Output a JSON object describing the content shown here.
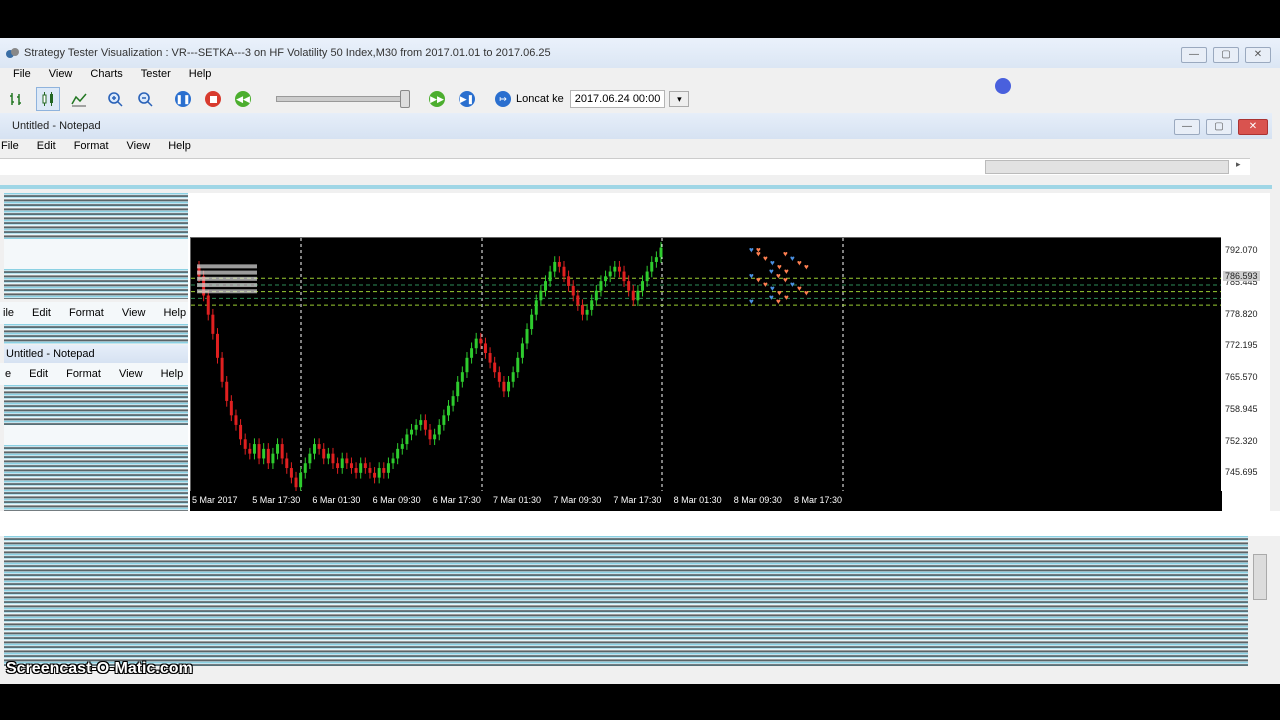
{
  "main_window": {
    "title": "Strategy Tester Visualization : VR---SETKA---3 on HF Volatility 50 Index,M30 from 2017.01.01 to 2017.06.25",
    "controls": {
      "minimize": "—",
      "maximize": "▢",
      "close": "✕"
    },
    "menu": [
      "File",
      "View",
      "Charts",
      "Tester",
      "Help"
    ]
  },
  "toolbar": {
    "jump_to_label": "Loncat ke",
    "date_value": "2017.06.24 00:00"
  },
  "notepad_main": {
    "title": "Untitled - Notepad",
    "menu": [
      "File",
      "Edit",
      "Format",
      "View",
      "Help"
    ],
    "controls": {
      "minimize": "—",
      "maximize": "▢",
      "close": "✕"
    }
  },
  "notepad_ghost_1": {
    "menu": [
      "ile",
      "Edit",
      "Format",
      "View",
      "Help"
    ]
  },
  "notepad_ghost_2": {
    "title": "Untitled - Notepad",
    "menu": [
      "e",
      "Edit",
      "Format",
      "View",
      "Help"
    ]
  },
  "chart_data": {
    "type": "candlestick",
    "price_axis_labels": [
      "792.070",
      "785.445",
      "778.820",
      "772.195",
      "765.570",
      "758.945",
      "752.320",
      "745.695"
    ],
    "current_price_label": "786.593",
    "ylim": [
      742,
      795
    ],
    "time_axis_labels": [
      "5 Mar 2017",
      "5 Mar 17:30",
      "6 Mar 01:30",
      "6 Mar 09:30",
      "6 Mar 17:30",
      "7 Mar 01:30",
      "7 Mar 09:30",
      "7 Mar 17:30",
      "8 Mar 01:30",
      "8 Mar 09:30",
      "8 Mar 17:30"
    ],
    "closes": [
      787,
      783,
      779,
      775,
      770,
      765,
      761,
      758,
      756,
      753,
      751,
      750,
      752,
      749,
      751,
      748,
      750,
      752,
      749,
      747,
      745,
      743,
      746,
      748,
      750,
      752,
      751,
      749,
      750,
      748,
      747,
      749,
      748,
      747,
      746,
      748,
      747,
      746,
      745,
      747,
      746,
      748,
      749,
      751,
      752,
      754,
      755,
      756,
      757,
      755,
      753,
      754,
      756,
      758,
      760,
      762,
      765,
      767,
      770,
      772,
      774,
      773,
      771,
      769,
      767,
      765,
      763,
      765,
      767,
      770,
      773,
      776,
      779,
      782,
      784,
      786,
      788,
      790,
      789,
      787,
      785,
      783,
      781,
      779,
      780,
      782,
      784,
      786,
      787,
      788,
      789,
      788,
      786,
      784,
      782,
      784,
      786,
      788,
      790,
      791,
      793
    ],
    "vlines": [
      300,
      481,
      661,
      842
    ]
  },
  "watermark": "Screencast-O-Matic.com"
}
